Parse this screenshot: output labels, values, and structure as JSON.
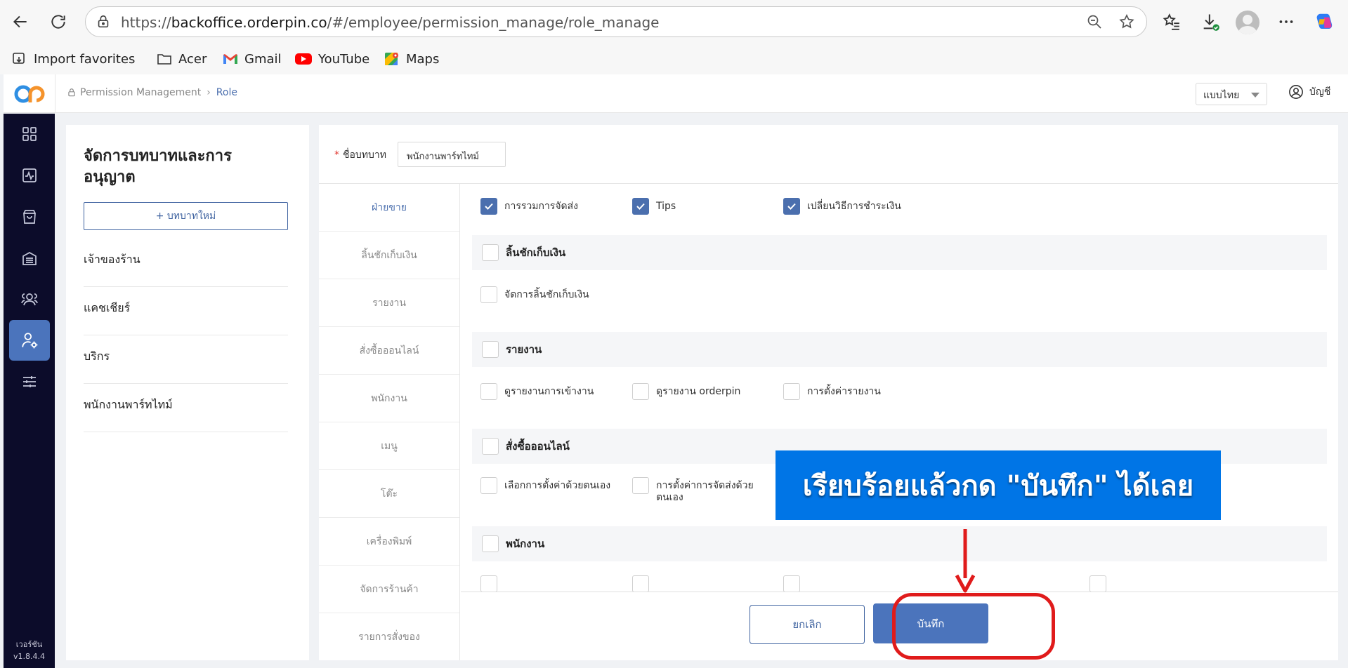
{
  "browser": {
    "url_prefix": "https://",
    "url_domain": "backoffice.orderpin.co",
    "url_path": "/#/employee/permission_manage/role_manage",
    "bookmarks": [
      "Import favorites",
      "Acer",
      "Gmail",
      "YouTube",
      "Maps"
    ]
  },
  "header": {
    "breadcrumb": [
      "Permission Management",
      "Role"
    ],
    "language": "แบบไทย",
    "account": "บัญชี"
  },
  "sidebar": {
    "icons": [
      "dashboard-icon",
      "analytics-icon",
      "shopping-bag-icon",
      "building-icon",
      "users-icon",
      "user-settings-icon",
      "sliders-icon"
    ],
    "active_index": 5,
    "version_label": "เวอร์ชัน",
    "version": "v1.8.4.4"
  },
  "roles_panel": {
    "title": "จัดการบทบาทและการอนุญาต",
    "new_role_button": "+ บทบาทใหม่",
    "roles": [
      "เจ้าของร้าน",
      "แคชเชียร์",
      "บริกร",
      "พนักงานพาร์ทไทม์"
    ]
  },
  "role_form": {
    "required_mark": "*",
    "name_label": "ชื่อบทบาท",
    "name_value": "พนักงานพาร์ทไทม์"
  },
  "tabs": {
    "items": [
      "ฝ่ายขาย",
      "ลิ้นชักเก็บเงิน",
      "รายงาน",
      "สั่งซื้อออนไลน์",
      "พนักงาน",
      "เมนู",
      "โต๊ะ",
      "เครื่องพิมพ์",
      "จัดการร้านค้า",
      "รายการสั่งของ"
    ],
    "active_index": 0
  },
  "permissions": {
    "sales": [
      {
        "label": "การรวมการจัดส่ง",
        "checked": true
      },
      {
        "label": "Tips",
        "checked": true
      },
      {
        "label": "เปลี่ยนวิธีการชำระเงิน",
        "checked": true
      }
    ],
    "cash_drawer": {
      "title": "ลิ้นชักเก็บเงิน",
      "items": [
        {
          "label": "จัดการลิ้นชักเก็บเงิน",
          "checked": false
        }
      ]
    },
    "reports": {
      "title": "รายงาน",
      "items": [
        {
          "label": "ดูรายงานการเข้างาน",
          "checked": false
        },
        {
          "label": "ดูรายงาน orderpin",
          "checked": false
        },
        {
          "label": "การตั้งค่ารายงาน",
          "checked": false
        }
      ]
    },
    "online_orders": {
      "title": "สั่งซื้อออนไลน์",
      "items": [
        {
          "label": "เลือกการตั้งค่าด้วยตนเอง",
          "checked": false
        },
        {
          "label": "การตั้งค่าการจัดส่งด้วยตนเอง",
          "checked": false
        }
      ]
    },
    "staff": {
      "title": "พนักงาน"
    }
  },
  "footer": {
    "cancel": "ยกเลิก",
    "save": "บันทึก"
  },
  "annotation": {
    "callout_text": "เรียบร้อยแล้วกด \"บันทึก\" ได้เลย",
    "callout_color": "#0075e6",
    "ring_color": "#e01b1b"
  }
}
